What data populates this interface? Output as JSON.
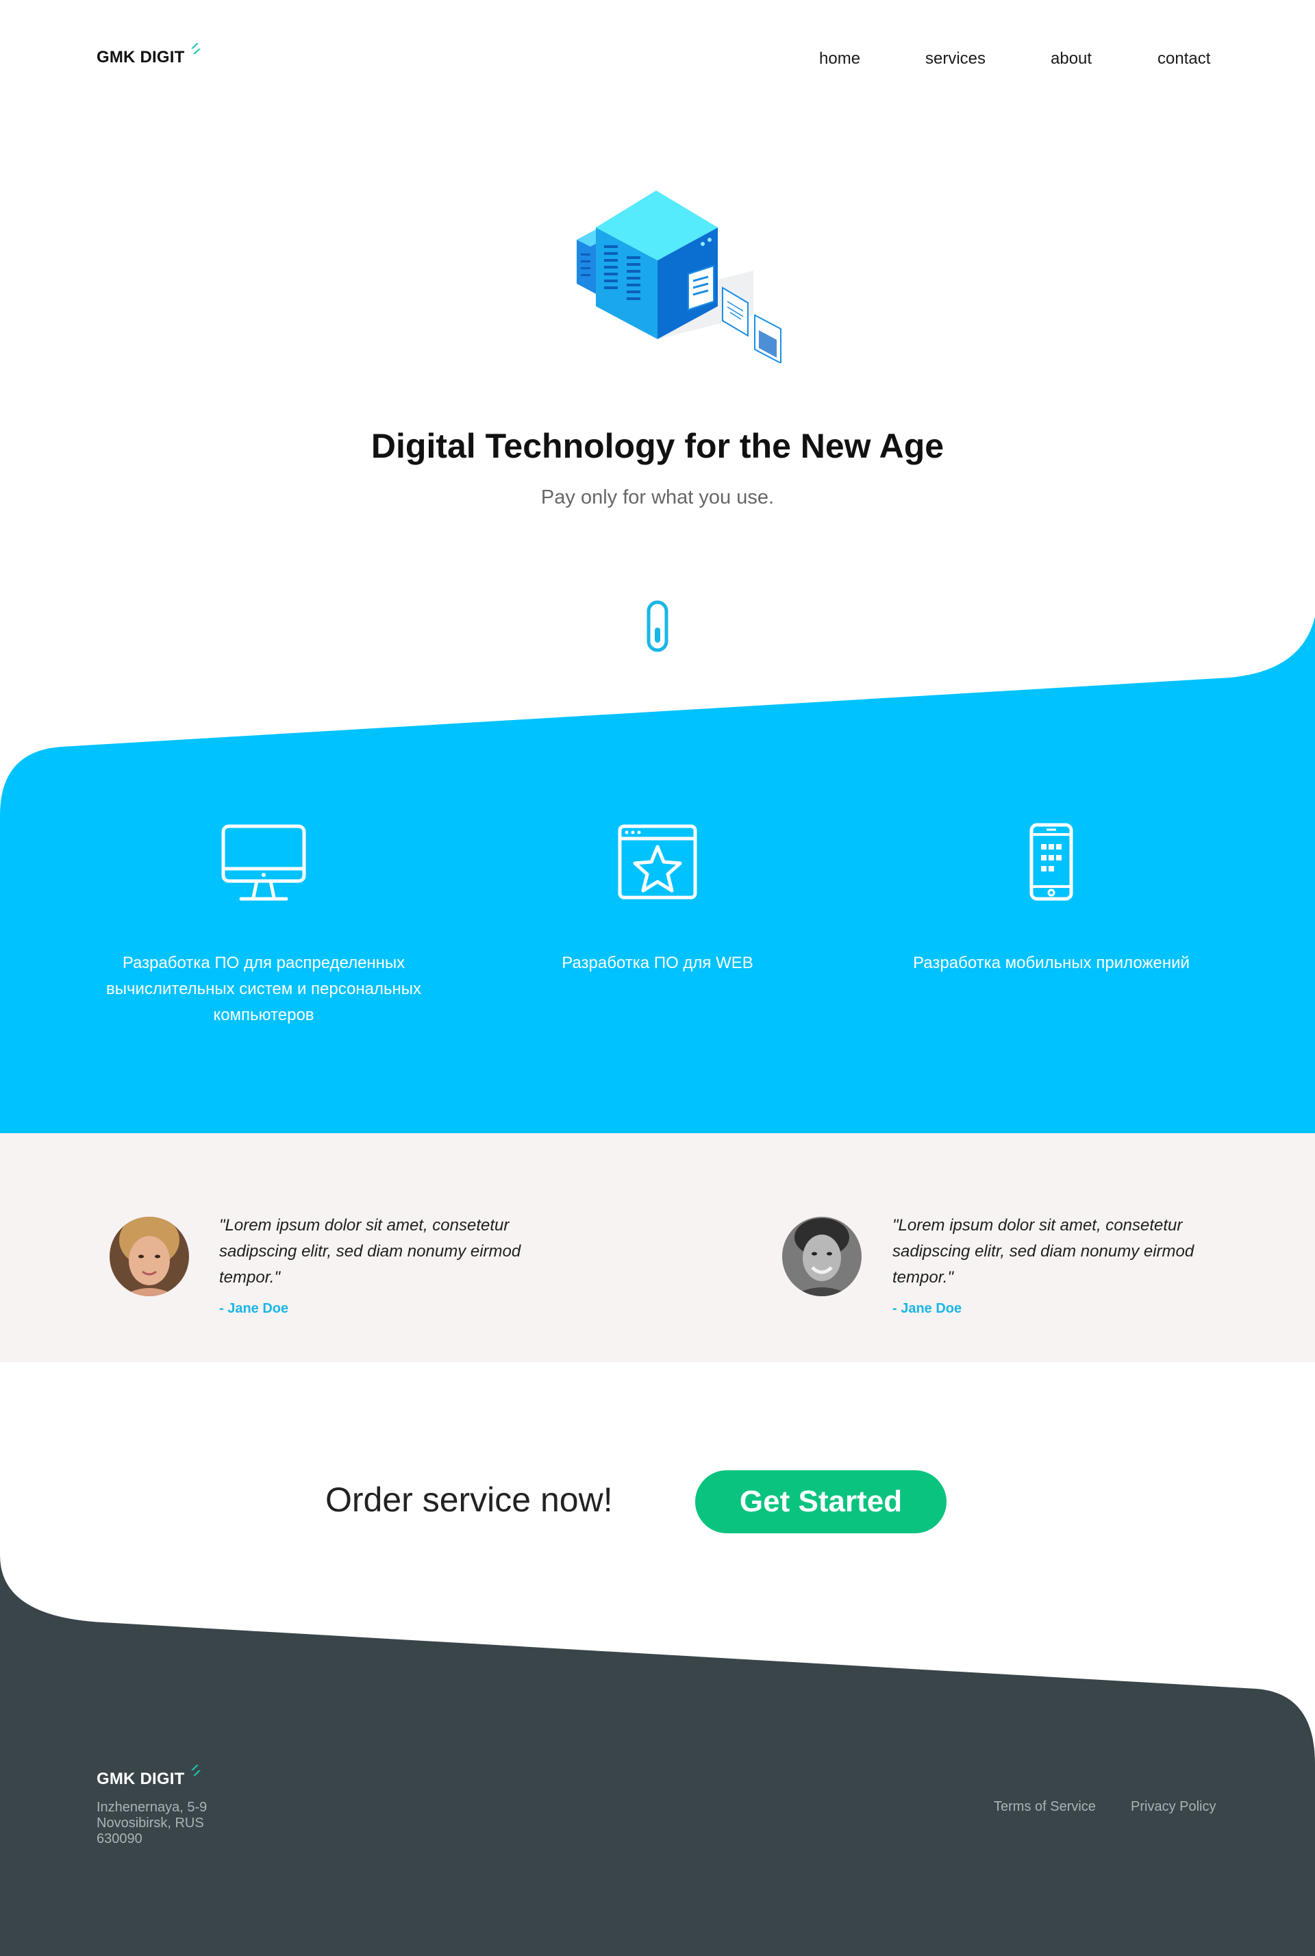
{
  "colors": {
    "accent_blue": "#00c2ff",
    "accent_green": "#0ac37f",
    "logo_teal": "#19c8b4",
    "footer_bg": "#3a454a",
    "testimonial_bg": "#f7f3f2"
  },
  "header": {
    "logo": "GMK DIGIT",
    "nav": [
      "home",
      "services",
      "about",
      "contact"
    ]
  },
  "hero": {
    "illustration": "server-isometric-illustration",
    "title": "Digital Technology for the New Age",
    "subtitle": "Pay only for what you use.",
    "scroll_icon": "scroll-down-icon"
  },
  "services": [
    {
      "icon": "desktop-monitor-icon",
      "text": "Разработка ПО для распределенных вычислительных систем и персональных компьютеров"
    },
    {
      "icon": "web-star-icon",
      "text": "Разработка ПО для WEB"
    },
    {
      "icon": "mobile-phone-icon",
      "text": "Разработка мобильных приложений"
    }
  ],
  "testimonials": [
    {
      "quote": "\"Lorem ipsum dolor sit amet, consetetur sadipscing elitr, sed diam nonumy eirmod tempor.\"",
      "author": "- Jane Doe"
    },
    {
      "quote": "\"Lorem ipsum dolor sit amet, consetetur sadipscing elitr, sed diam nonumy eirmod tempor.\"",
      "author": "- Jane Doe"
    }
  ],
  "cta": {
    "text": "Order service now!",
    "button": "Get Started"
  },
  "footer": {
    "logo": "GMK DIGIT",
    "address": [
      "Inzhenernaya, 5-9",
      "Novosibirsk, RUS",
      "630090"
    ],
    "links": [
      "Terms of Service",
      "Privacy Policy"
    ]
  }
}
